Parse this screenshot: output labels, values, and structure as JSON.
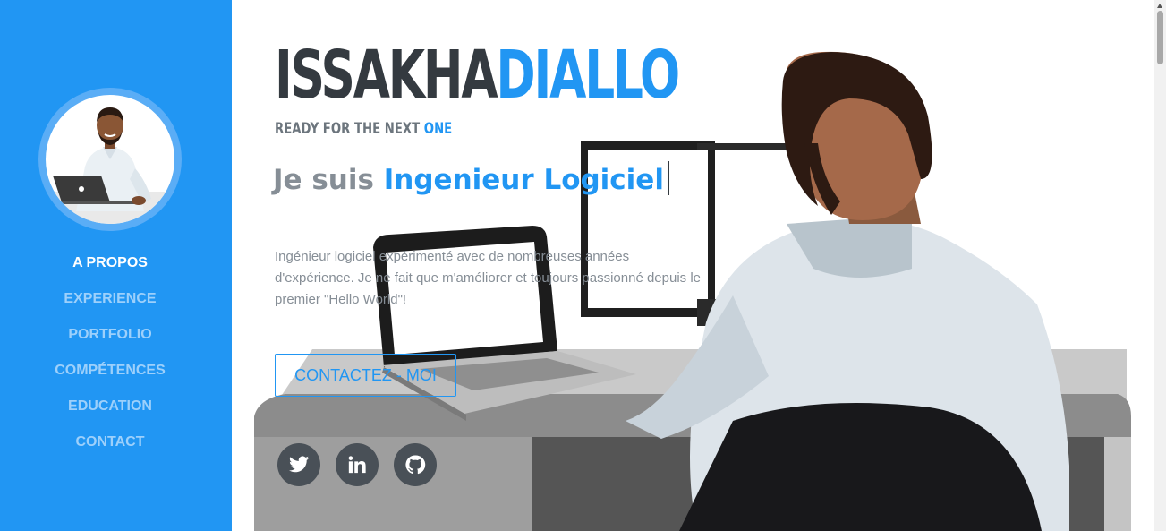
{
  "profile": {
    "photo_icon": "developer-avatar-illustration"
  },
  "nav": {
    "items": [
      {
        "label": "A PROPOS",
        "active": true
      },
      {
        "label": "EXPERIENCE",
        "active": false
      },
      {
        "label": "PORTFOLIO",
        "active": false
      },
      {
        "label": "COMPÉTENCES",
        "active": false
      },
      {
        "label": "EDUCATION",
        "active": false
      },
      {
        "label": "CONTACT",
        "active": false
      }
    ]
  },
  "hero": {
    "first_name": "ISSAKHA",
    "last_name": "DIALLO",
    "tagline_prefix": "READY FOR THE NEXT",
    "tagline_highlight": "ONE",
    "headline_lead": "Je suis",
    "headline_role": "Ingenieur Logiciel",
    "bio": "Ingénieur logiciel expérimenté avec de nombreuses années d'expérience. Je ne fait que m'améliorer et toujours passionné depuis le premier \"Hello World\"!",
    "cta_label": "CONTACTEZ - MOI",
    "background_icon": "developer-at-desk-illustration"
  },
  "social": [
    {
      "name": "twitter",
      "icon": "twitter-icon"
    },
    {
      "name": "linkedin",
      "icon": "linkedin-icon"
    },
    {
      "name": "github",
      "icon": "github-icon"
    }
  ],
  "colors": {
    "sidebar": "#2196f3",
    "accent": "#2196f3",
    "name_dark": "#343a40",
    "muted_text": "#868e96",
    "social_button": "#495057"
  }
}
